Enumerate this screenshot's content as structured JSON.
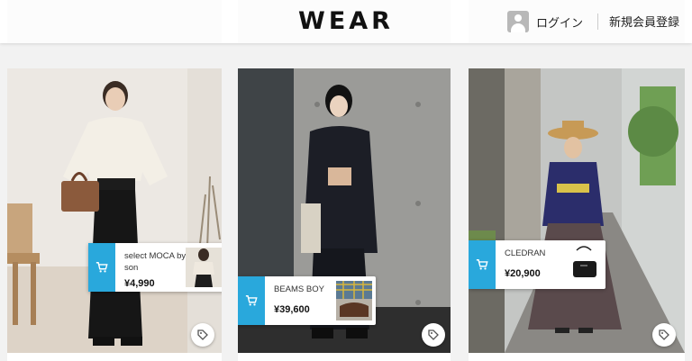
{
  "header": {
    "logo": "WEAR",
    "login_label": "ログイン",
    "register_label": "新規会員登録"
  },
  "accent_color": "#29a8dc",
  "cards": [
    {
      "chip": {
        "brand": "select MOCA by son",
        "price": "¥4,990"
      }
    },
    {
      "chip": {
        "brand": "BEAMS BOY",
        "price": "¥39,600"
      }
    },
    {
      "chip": {
        "brand": "CLEDRAN",
        "price": "¥20,900"
      }
    }
  ]
}
